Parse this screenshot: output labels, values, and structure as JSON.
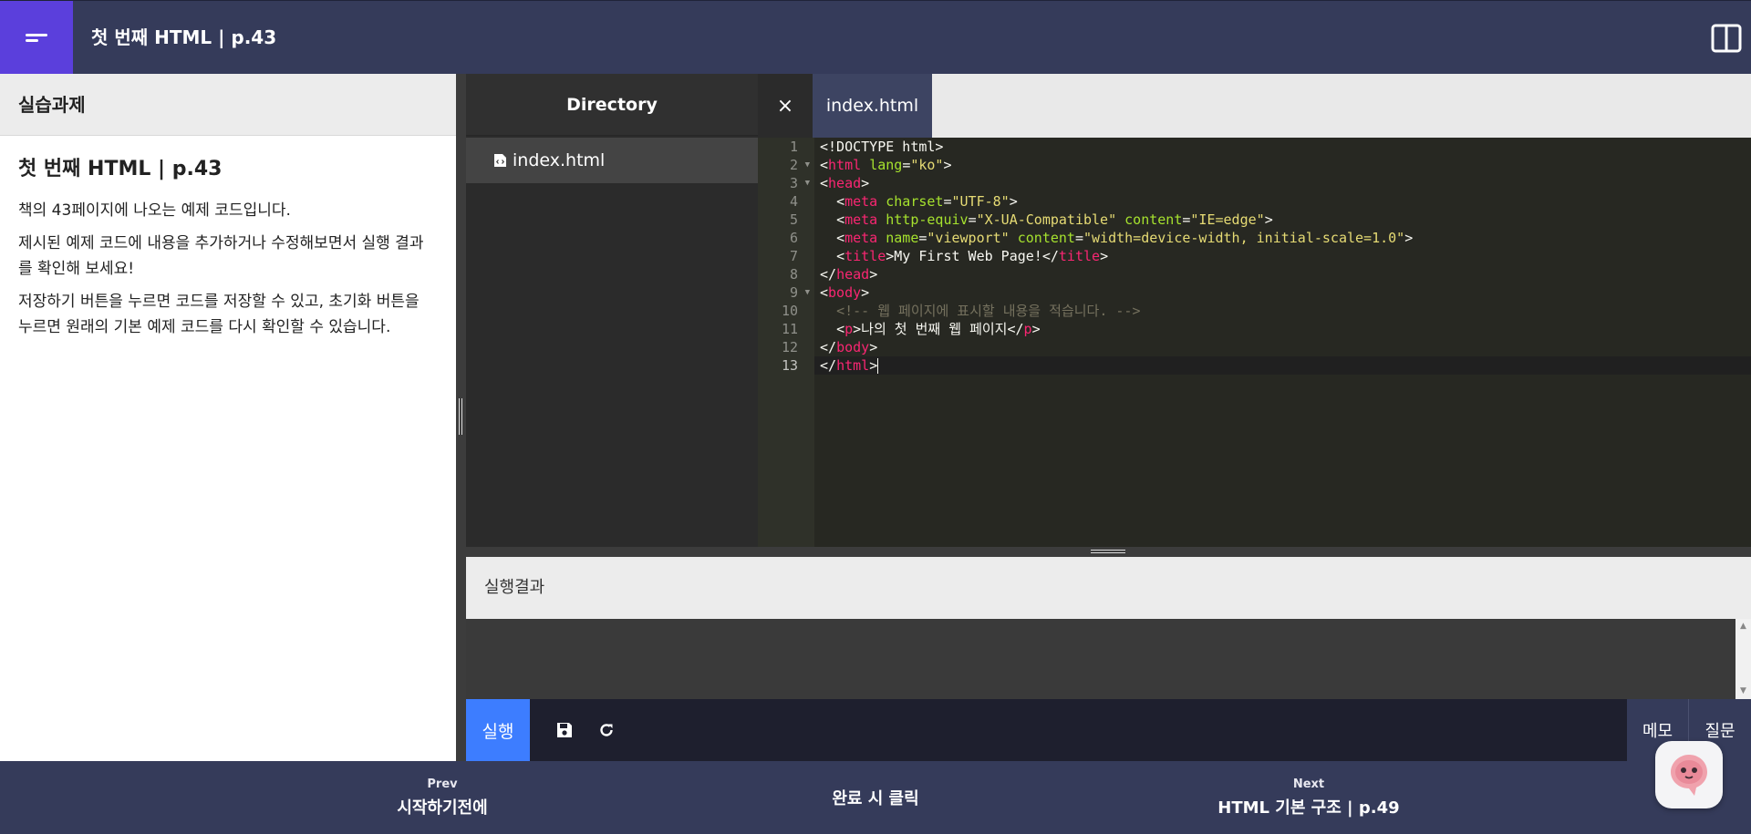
{
  "header": {
    "title": "첫 번째 HTML | p.43"
  },
  "left_panel": {
    "header": "실습과제",
    "title": "첫 번째 HTML | p.43",
    "paragraphs": [
      "책의 43페이지에 나오는 예제 코드입니다.",
      "제시된 예제 코드에 내용을 추가하거나 수정해보면서 실행 결과를 확인해 보세요!",
      "저장하기 버튼을 누르면 코드를 저장할 수 있고, 초기화 버튼을 누르면 원래의 기본 예제 코드를 다시 확인할 수 있습니다."
    ]
  },
  "directory": {
    "header": "Directory",
    "files": [
      "index.html"
    ]
  },
  "tabs": {
    "close_symbol": "×",
    "items": [
      {
        "label": "index.html"
      }
    ]
  },
  "editor": {
    "line_numbers": [
      "1",
      "2",
      "3",
      "4",
      "5",
      "6",
      "7",
      "8",
      "9",
      "10",
      "11",
      "12",
      "13"
    ],
    "current_line": 13,
    "code": {
      "l1_text": "<!DOCTYPE html>",
      "lt": "<",
      "gt": ">",
      "lt_slash": "</",
      "eq": "=",
      "space": " ",
      "indent": "  ",
      "tag_html": "html",
      "tag_head": "head",
      "tag_meta": "meta",
      "tag_title": "title",
      "tag_body": "body",
      "tag_p": "p",
      "attr_lang": "lang",
      "val_ko": "\"ko\"",
      "attr_charset": "charset",
      "val_utf8": "\"UTF-8\"",
      "attr_http_equiv": "http-equiv",
      "val_xua": "\"X-UA-Compatible\"",
      "attr_content": "content",
      "val_ie_edge": "\"IE=edge\"",
      "attr_name": "name",
      "val_viewport": "\"viewport\"",
      "val_viewport_content": "\"width=device-width, initial-scale=1.0\"",
      "title_text": "My First Web Page!",
      "comment": "<!-- 웹 페이지에 표시할 내용을 적습니다. -->",
      "p_text": "나의 첫 번째 웹 페이지"
    }
  },
  "result": {
    "header": "실행결과"
  },
  "actions": {
    "run_label": "실행",
    "save_icon": "floppy-disk-icon",
    "reset_icon": "refresh-icon",
    "memo_label": "메모",
    "question_label": "질문"
  },
  "footer": {
    "prev_label": "Prev",
    "prev_title": "시작하기전에",
    "complete_label": "완료 시 클릭",
    "next_label": "Next",
    "next_title": "HTML 기본 구조 | p.49"
  },
  "colors": {
    "topbar": "#353b5a",
    "menu_accent": "#5b3fdc",
    "run_button": "#3d7dff",
    "editor_bg": "#272822",
    "tag": "#f92672",
    "attr": "#a6e22e",
    "string": "#e6db74",
    "comment": "#75715e"
  }
}
